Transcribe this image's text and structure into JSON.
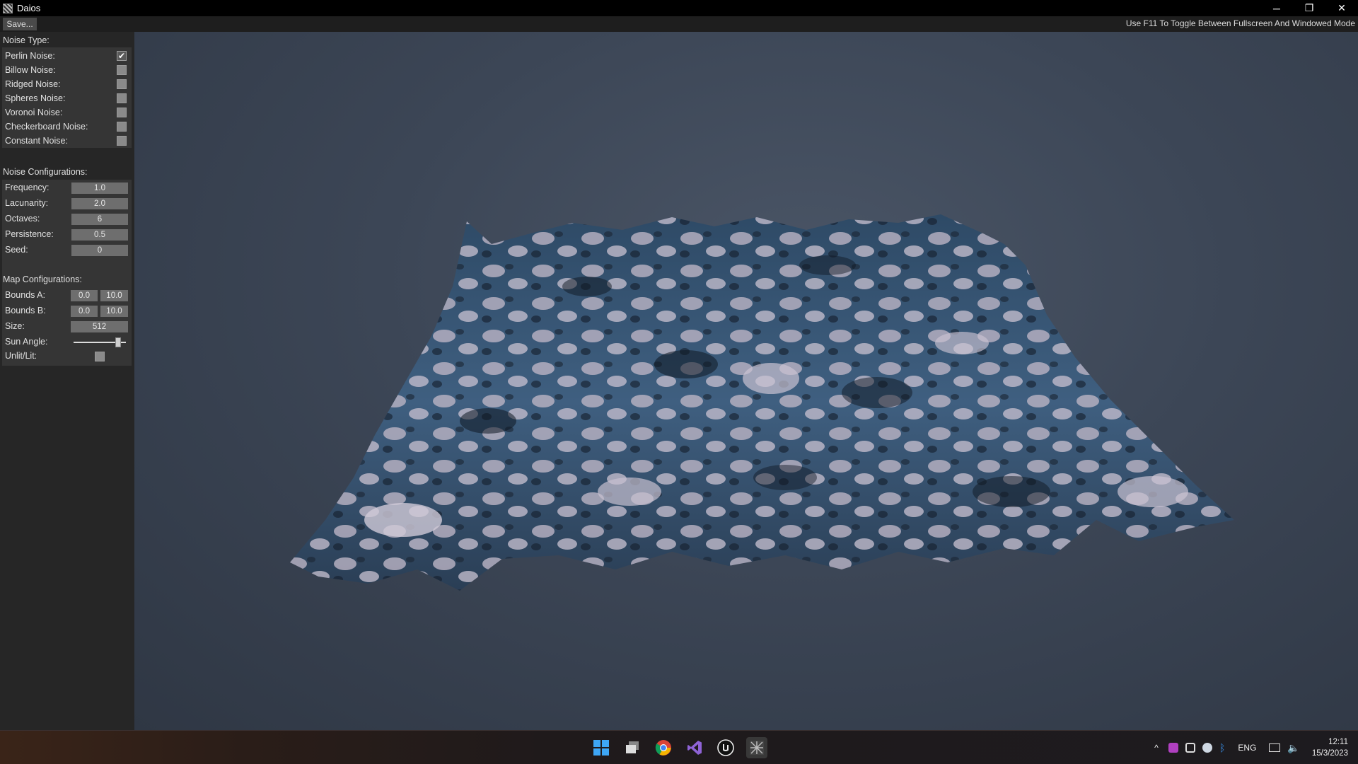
{
  "window": {
    "title": "Daios",
    "minimize_glyph": "─",
    "maximize_glyph": "❐",
    "close_glyph": "✕"
  },
  "menu": {
    "save_label": "Save...",
    "hint": "Use F11 To Toggle Between Fullscreen And Windowed Mode"
  },
  "noise_type": {
    "title": "Noise Type:",
    "items": [
      {
        "label": "Perlin Noise:",
        "checked": true
      },
      {
        "label": "Billow Noise:",
        "checked": false
      },
      {
        "label": "Ridged Noise:",
        "checked": false
      },
      {
        "label": "Spheres Noise:",
        "checked": false
      },
      {
        "label": "Voronoi Noise:",
        "checked": false
      },
      {
        "label": "Checkerboard Noise:",
        "checked": false
      },
      {
        "label": "Constant Noise:",
        "checked": false
      }
    ],
    "check_glyph": "✔"
  },
  "noise_config": {
    "title": "Noise Configurations:",
    "fields": [
      {
        "label": "Frequency:",
        "value": "1.0"
      },
      {
        "label": "Lacunarity:",
        "value": "2.0"
      },
      {
        "label": "Octaves:",
        "value": "6"
      },
      {
        "label": "Persistence:",
        "value": "0.5"
      },
      {
        "label": "Seed:",
        "value": "0"
      }
    ]
  },
  "map_config": {
    "title": "Map Configurations:",
    "bounds_a": {
      "label": "Bounds A:",
      "min": "0.0",
      "max": "10.0"
    },
    "bounds_b": {
      "label": "Bounds B:",
      "min": "0.0",
      "max": "10.0"
    },
    "size": {
      "label": "Size:",
      "value": "512"
    },
    "sun_angle": {
      "label": "Sun Angle:",
      "level": 0.85
    },
    "unlit": {
      "label": "Unlit/Lit:",
      "checked": false
    }
  },
  "taskbar": {
    "apps": [
      "windows-start-icon",
      "task-view-icon",
      "chrome-icon",
      "visual-studio-icon",
      "unreal-engine-icon",
      "daios-app-icon"
    ],
    "tray": {
      "chevron": "^",
      "language": "ENG",
      "time": "12:11",
      "date": "15/3/2023"
    },
    "colors": {
      "start": "#3ea6f5",
      "vs": "#8f63d6"
    }
  }
}
